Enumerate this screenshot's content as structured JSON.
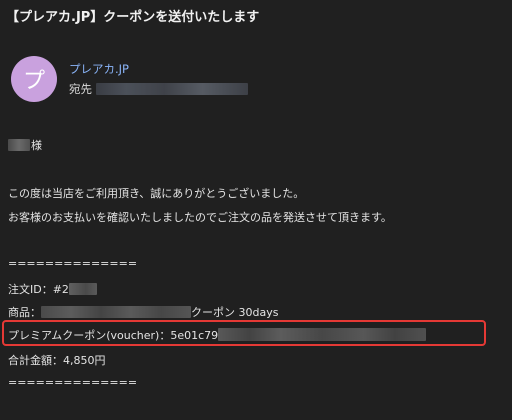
{
  "email": {
    "subject": "【プレアカ.JP】クーポンを送付いたします",
    "avatar_letter": "プ",
    "avatar_color": "#c9a1de",
    "sender_name": "プレアカ.JP",
    "to_label": "宛先"
  },
  "body": {
    "greeting_suffix": "様",
    "line1": "この度は当店をご利用頂き、誠にありがとうございました。",
    "line2": "お客様のお支払いを確認いたしましたのでご注文の品を発送させて頂きます。",
    "separator": "==============",
    "order_label": "注文ID：#2",
    "product_label": "商品：",
    "product_suffix": "クーポン 30days",
    "voucher_label": "プレミアムクーポン(voucher)：5e01c79",
    "total": "合計金額：4,850円"
  },
  "highlight_color": "#e53935"
}
